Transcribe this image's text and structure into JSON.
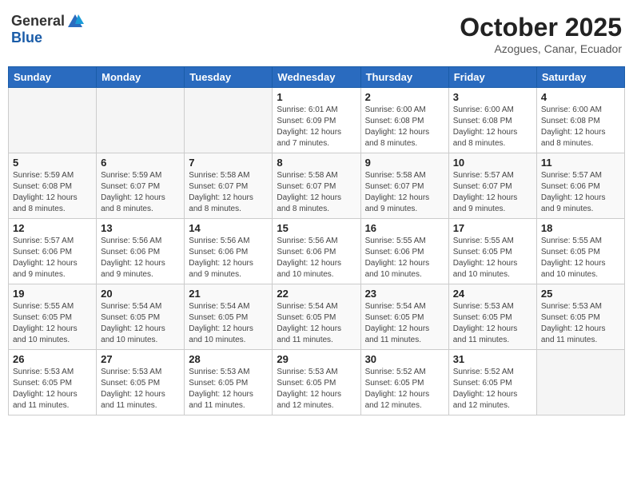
{
  "header": {
    "logo_general": "General",
    "logo_blue": "Blue",
    "month_title": "October 2025",
    "location": "Azogues, Canar, Ecuador"
  },
  "weekdays": [
    "Sunday",
    "Monday",
    "Tuesday",
    "Wednesday",
    "Thursday",
    "Friday",
    "Saturday"
  ],
  "weeks": [
    [
      {
        "day": "",
        "info": ""
      },
      {
        "day": "",
        "info": ""
      },
      {
        "day": "",
        "info": ""
      },
      {
        "day": "1",
        "info": "Sunrise: 6:01 AM\nSunset: 6:09 PM\nDaylight: 12 hours\nand 7 minutes."
      },
      {
        "day": "2",
        "info": "Sunrise: 6:00 AM\nSunset: 6:08 PM\nDaylight: 12 hours\nand 8 minutes."
      },
      {
        "day": "3",
        "info": "Sunrise: 6:00 AM\nSunset: 6:08 PM\nDaylight: 12 hours\nand 8 minutes."
      },
      {
        "day": "4",
        "info": "Sunrise: 6:00 AM\nSunset: 6:08 PM\nDaylight: 12 hours\nand 8 minutes."
      }
    ],
    [
      {
        "day": "5",
        "info": "Sunrise: 5:59 AM\nSunset: 6:08 PM\nDaylight: 12 hours\nand 8 minutes."
      },
      {
        "day": "6",
        "info": "Sunrise: 5:59 AM\nSunset: 6:07 PM\nDaylight: 12 hours\nand 8 minutes."
      },
      {
        "day": "7",
        "info": "Sunrise: 5:58 AM\nSunset: 6:07 PM\nDaylight: 12 hours\nand 8 minutes."
      },
      {
        "day": "8",
        "info": "Sunrise: 5:58 AM\nSunset: 6:07 PM\nDaylight: 12 hours\nand 8 minutes."
      },
      {
        "day": "9",
        "info": "Sunrise: 5:58 AM\nSunset: 6:07 PM\nDaylight: 12 hours\nand 9 minutes."
      },
      {
        "day": "10",
        "info": "Sunrise: 5:57 AM\nSunset: 6:07 PM\nDaylight: 12 hours\nand 9 minutes."
      },
      {
        "day": "11",
        "info": "Sunrise: 5:57 AM\nSunset: 6:06 PM\nDaylight: 12 hours\nand 9 minutes."
      }
    ],
    [
      {
        "day": "12",
        "info": "Sunrise: 5:57 AM\nSunset: 6:06 PM\nDaylight: 12 hours\nand 9 minutes."
      },
      {
        "day": "13",
        "info": "Sunrise: 5:56 AM\nSunset: 6:06 PM\nDaylight: 12 hours\nand 9 minutes."
      },
      {
        "day": "14",
        "info": "Sunrise: 5:56 AM\nSunset: 6:06 PM\nDaylight: 12 hours\nand 9 minutes."
      },
      {
        "day": "15",
        "info": "Sunrise: 5:56 AM\nSunset: 6:06 PM\nDaylight: 12 hours\nand 10 minutes."
      },
      {
        "day": "16",
        "info": "Sunrise: 5:55 AM\nSunset: 6:06 PM\nDaylight: 12 hours\nand 10 minutes."
      },
      {
        "day": "17",
        "info": "Sunrise: 5:55 AM\nSunset: 6:05 PM\nDaylight: 12 hours\nand 10 minutes."
      },
      {
        "day": "18",
        "info": "Sunrise: 5:55 AM\nSunset: 6:05 PM\nDaylight: 12 hours\nand 10 minutes."
      }
    ],
    [
      {
        "day": "19",
        "info": "Sunrise: 5:55 AM\nSunset: 6:05 PM\nDaylight: 12 hours\nand 10 minutes."
      },
      {
        "day": "20",
        "info": "Sunrise: 5:54 AM\nSunset: 6:05 PM\nDaylight: 12 hours\nand 10 minutes."
      },
      {
        "day": "21",
        "info": "Sunrise: 5:54 AM\nSunset: 6:05 PM\nDaylight: 12 hours\nand 10 minutes."
      },
      {
        "day": "22",
        "info": "Sunrise: 5:54 AM\nSunset: 6:05 PM\nDaylight: 12 hours\nand 11 minutes."
      },
      {
        "day": "23",
        "info": "Sunrise: 5:54 AM\nSunset: 6:05 PM\nDaylight: 12 hours\nand 11 minutes."
      },
      {
        "day": "24",
        "info": "Sunrise: 5:53 AM\nSunset: 6:05 PM\nDaylight: 12 hours\nand 11 minutes."
      },
      {
        "day": "25",
        "info": "Sunrise: 5:53 AM\nSunset: 6:05 PM\nDaylight: 12 hours\nand 11 minutes."
      }
    ],
    [
      {
        "day": "26",
        "info": "Sunrise: 5:53 AM\nSunset: 6:05 PM\nDaylight: 12 hours\nand 11 minutes."
      },
      {
        "day": "27",
        "info": "Sunrise: 5:53 AM\nSunset: 6:05 PM\nDaylight: 12 hours\nand 11 minutes."
      },
      {
        "day": "28",
        "info": "Sunrise: 5:53 AM\nSunset: 6:05 PM\nDaylight: 12 hours\nand 11 minutes."
      },
      {
        "day": "29",
        "info": "Sunrise: 5:53 AM\nSunset: 6:05 PM\nDaylight: 12 hours\nand 12 minutes."
      },
      {
        "day": "30",
        "info": "Sunrise: 5:52 AM\nSunset: 6:05 PM\nDaylight: 12 hours\nand 12 minutes."
      },
      {
        "day": "31",
        "info": "Sunrise: 5:52 AM\nSunset: 6:05 PM\nDaylight: 12 hours\nand 12 minutes."
      },
      {
        "day": "",
        "info": ""
      }
    ]
  ]
}
